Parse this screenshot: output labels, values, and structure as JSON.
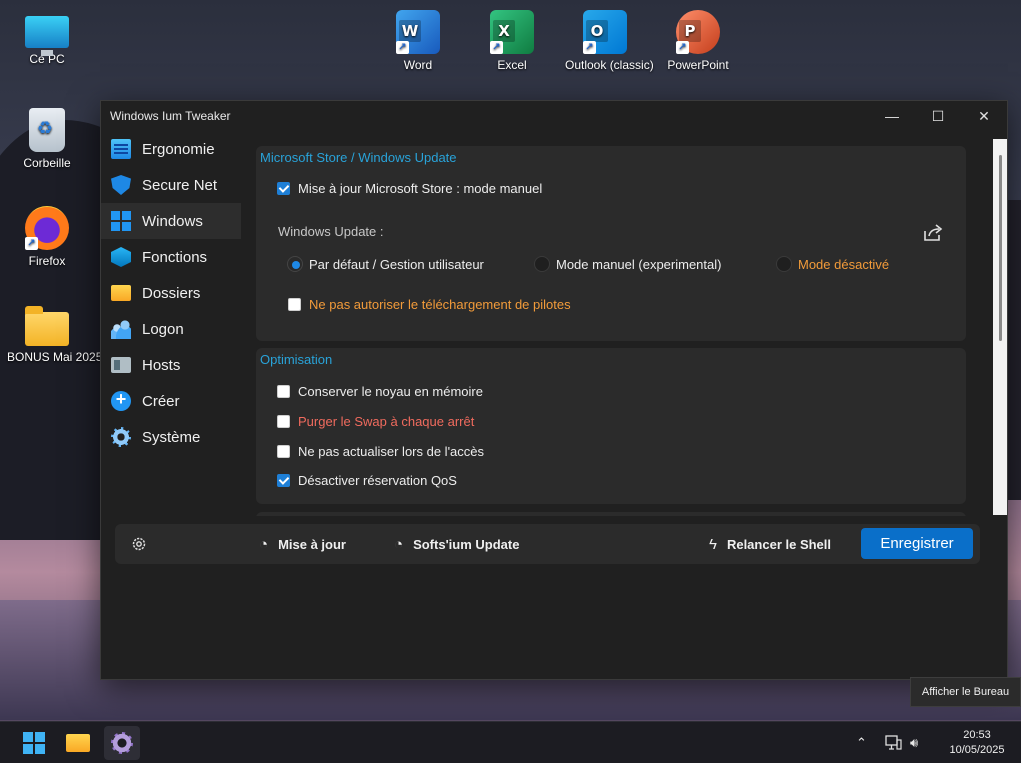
{
  "desktop": {
    "icons": [
      {
        "label": "Ce PC",
        "icon": "computer-icon"
      },
      {
        "label": "Corbeille",
        "icon": "recycle-bin-icon"
      },
      {
        "label": "Firefox",
        "icon": "firefox-icon"
      },
      {
        "label": "BONUS Mai 2025",
        "icon": "folder-icon"
      },
      {
        "label": "Word",
        "icon": "word-icon",
        "letter": "W"
      },
      {
        "label": "Excel",
        "icon": "excel-icon",
        "letter": "X"
      },
      {
        "label": "Outlook (classic)",
        "icon": "outlook-icon",
        "letter": "O"
      },
      {
        "label": "PowerPoint",
        "icon": "powerpoint-icon",
        "letter": "P"
      }
    ]
  },
  "window": {
    "title": "Windows Ium Tweaker",
    "controls": {
      "minimize": "—",
      "maximize": "☐",
      "close": "✕"
    }
  },
  "sidebar": {
    "items": [
      {
        "label": "Ergonomie",
        "icon": "ergonomie-icon",
        "active": false
      },
      {
        "label": "Secure Net",
        "icon": "shield-icon",
        "active": false
      },
      {
        "label": "Windows",
        "icon": "windows-logo-icon",
        "active": true
      },
      {
        "label": "Fonctions",
        "icon": "cube-icon",
        "active": false
      },
      {
        "label": "Dossiers",
        "icon": "folder-icon",
        "active": false
      },
      {
        "label": "Logon",
        "icon": "users-icon",
        "active": false
      },
      {
        "label": "Hosts",
        "icon": "hosts-icon",
        "active": false
      },
      {
        "label": "Créer",
        "icon": "plus-circle-icon",
        "active": false
      },
      {
        "label": "Système",
        "icon": "gear-icon",
        "active": false
      }
    ]
  },
  "store_panel": {
    "title": "Microsoft Store / Windows Update",
    "store_manual": {
      "label": "Mise à jour Microsoft Store : mode manuel",
      "checked": true
    },
    "wu_label": "Windows Update :",
    "wu_options": [
      {
        "label": "Par défaut / Gestion utilisateur",
        "selected": true
      },
      {
        "label": "Mode manuel (experimental)",
        "selected": false
      },
      {
        "label": "Mode désactivé",
        "selected": false
      }
    ],
    "no_drivers": {
      "label": "Ne pas autoriser le téléchargement de pilotes",
      "checked": false
    }
  },
  "optim_panel": {
    "title": "Optimisation",
    "options": [
      {
        "label": "Conserver le noyau en mémoire",
        "checked": false,
        "color": "#ededed"
      },
      {
        "label": "Purger le Swap à chaque arrêt",
        "checked": false,
        "color": "#f06b5e"
      },
      {
        "label": "Ne pas actualiser lors de l'accès",
        "checked": false,
        "color": "#ededed"
      },
      {
        "label": "Désactiver réservation QoS",
        "checked": true,
        "color": "#ededed"
      }
    ]
  },
  "footer": {
    "update_label": "Mise à jour",
    "softs_label": "Softs'ium Update",
    "restart_shell_label": "Relancer le Shell",
    "save_label": "Enregistrer"
  },
  "tooltip": "Afficher le Bureau",
  "taskbar": {
    "time": "20:53",
    "date": "10/05/2025"
  },
  "colors": {
    "accent": "#1e88e5",
    "section_title": "#29a3d9",
    "warning_orange": "#f29b3a",
    "danger_red": "#f06b5e",
    "save_button": "#0a6fc9"
  }
}
